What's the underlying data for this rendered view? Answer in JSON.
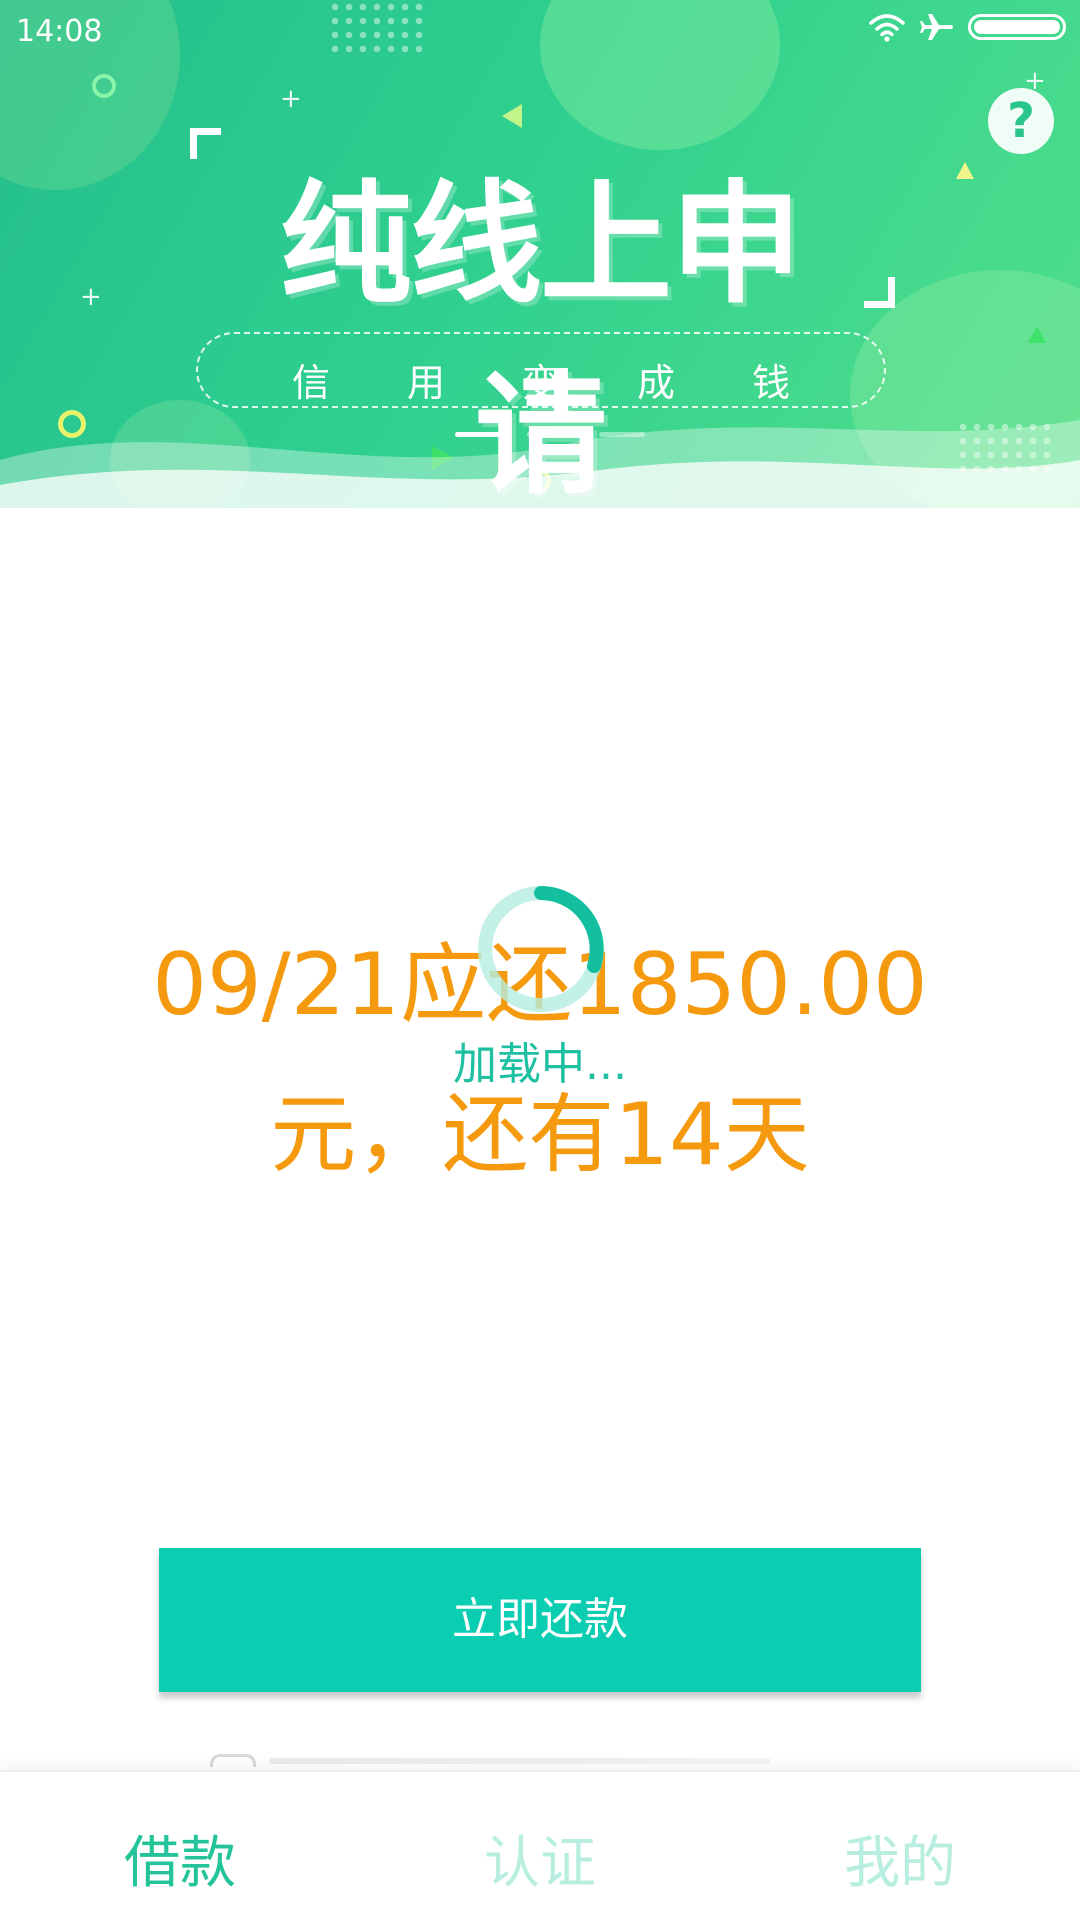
{
  "status_bar": {
    "time": "14:08"
  },
  "banner": {
    "title": "纯线上申请",
    "subtitle_chars": [
      "信",
      "用",
      "变",
      "成",
      "钱"
    ],
    "page_count": 3,
    "active_page": 1
  },
  "help": {
    "label": "?"
  },
  "main": {
    "due_line1": "09/21应还1850.00",
    "due_line2": "元，还有14天",
    "loading_text": "加载中...",
    "repay_button": "立即还款"
  },
  "nav": {
    "items": [
      "借款",
      "认证",
      "我的"
    ],
    "active": "借款"
  },
  "colors": {
    "accent": "#0acdb1",
    "due_text": "#f59a0e",
    "nav_active": "#25c39a",
    "nav_inactive": "#b7eedf"
  },
  "icons": [
    "wifi-icon",
    "airplane-mode-icon",
    "battery-icon",
    "help-icon",
    "loading-spinner-icon"
  ]
}
